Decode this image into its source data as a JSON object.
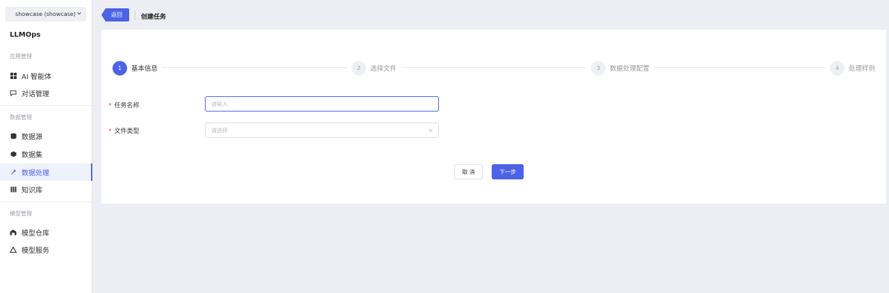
{
  "sidebar": {
    "project": "showcase (showcase)",
    "brand": "LLMOps",
    "groups": [
      {
        "title": "应用管理",
        "items": [
          {
            "label": "AI 智能体",
            "icon": "grid-icon"
          },
          {
            "label": "对话管理",
            "icon": "chat-icon"
          }
        ]
      },
      {
        "title": "数据管理",
        "items": [
          {
            "label": "数据源",
            "icon": "database-icon"
          },
          {
            "label": "数据集",
            "icon": "cube-icon"
          },
          {
            "label": "数据处理",
            "icon": "wrench-icon"
          },
          {
            "label": "知识库",
            "icon": "library-icon"
          }
        ]
      },
      {
        "title": "模型管理",
        "items": [
          {
            "label": "模型仓库",
            "icon": "warehouse-icon"
          },
          {
            "label": "模型服务",
            "icon": "triangle-icon"
          }
        ]
      }
    ],
    "active_item": "数据处理"
  },
  "header": {
    "back_label": "返回",
    "title": "创建任务"
  },
  "steps": [
    {
      "num": "1",
      "label": "基本信息",
      "active": true
    },
    {
      "num": "2",
      "label": "选择文件",
      "active": false
    },
    {
      "num": "3",
      "label": "数据处理配置",
      "active": false
    },
    {
      "num": "4",
      "label": "处理样例",
      "active": false
    }
  ],
  "form": {
    "task_name": {
      "label": "任务名称",
      "required": "*",
      "placeholder": "请输入",
      "value": ""
    },
    "file_type": {
      "label": "文件类型",
      "required": "*",
      "placeholder": "请选择"
    }
  },
  "actions": {
    "cancel": "取 消",
    "next": "下一步"
  },
  "colors": {
    "accent": "#4d63e6",
    "required": "#f0444d",
    "background": "#eceef3"
  }
}
